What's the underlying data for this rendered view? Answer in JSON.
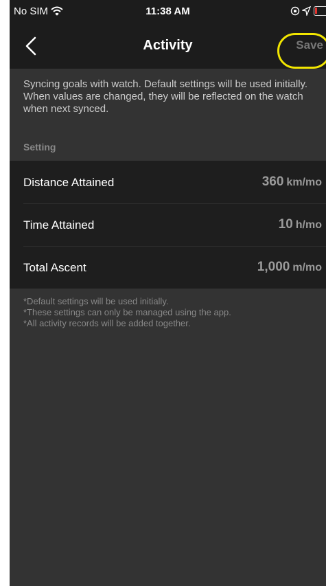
{
  "status_bar": {
    "carrier": "No SIM",
    "time": "11:38 AM",
    "icons": [
      "wifi-icon",
      "orientation-lock-icon",
      "location-icon",
      "battery-icon"
    ]
  },
  "nav": {
    "title": "Activity",
    "save_label": "Save",
    "back_icon": "chevron-left-icon"
  },
  "intro": "Syncing goals with watch. Default settings will be used initially. When values are changed, they will be reflected on the watch when next synced.",
  "section_title": "Setting",
  "settings": [
    {
      "label": "Distance Attained",
      "value": "360",
      "unit": "km/mo"
    },
    {
      "label": "Time Attained",
      "value": "10",
      "unit": "h/mo"
    },
    {
      "label": "Total Ascent",
      "value": "1,000",
      "unit": "m/mo"
    }
  ],
  "footnotes": [
    "*Default settings will be used initially.",
    "*These settings can only be managed using the app.",
    "*All activity records will be added together."
  ],
  "colors": {
    "background": "#333333",
    "nav_background": "#1c1c1c",
    "list_background": "#1e1e1e",
    "highlight": "#f2e600",
    "battery_low": "#e5322d"
  }
}
